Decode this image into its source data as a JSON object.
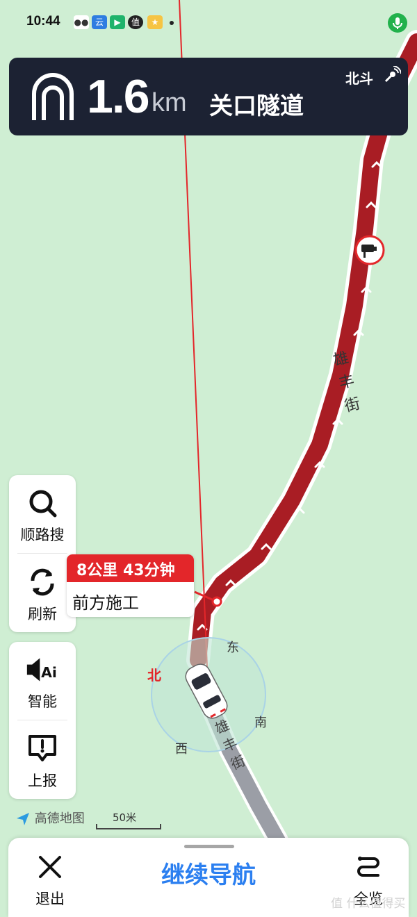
{
  "status_bar": {
    "time": "10:44",
    "app_icons": [
      "wechat-icon",
      "cloud-app-icon",
      "video-app-icon",
      "zhi-app-icon",
      "photo-app-icon"
    ],
    "mic_color": "#22b14c"
  },
  "guidance": {
    "maneuver_icon": "tunnel-icon",
    "distance": "1.6",
    "unit": "km",
    "road": "关口隧道",
    "gnss": "北斗"
  },
  "map": {
    "street_label_top": "雄丰街",
    "street_label_bottom": "雄丰街",
    "compass": {
      "north": "北",
      "east": "东",
      "south": "南",
      "west": "西"
    },
    "route_color": "#a91d24",
    "logo": "高德地图",
    "scale": "50米"
  },
  "route_bubble": {
    "summary": "8公里 43分钟",
    "notice": "前方施工"
  },
  "side_tools": [
    {
      "icon": "search-icon",
      "label": "顺路搜"
    },
    {
      "icon": "refresh-icon",
      "label": "刷新"
    },
    {
      "icon": "ai-voice-icon",
      "label": "智能"
    },
    {
      "icon": "report-icon",
      "label": "上报"
    }
  ],
  "bottom": {
    "exit_label": "退出",
    "resume_label": "继续导航",
    "overview_label": "全览"
  },
  "watermark": "值 什么值得买"
}
